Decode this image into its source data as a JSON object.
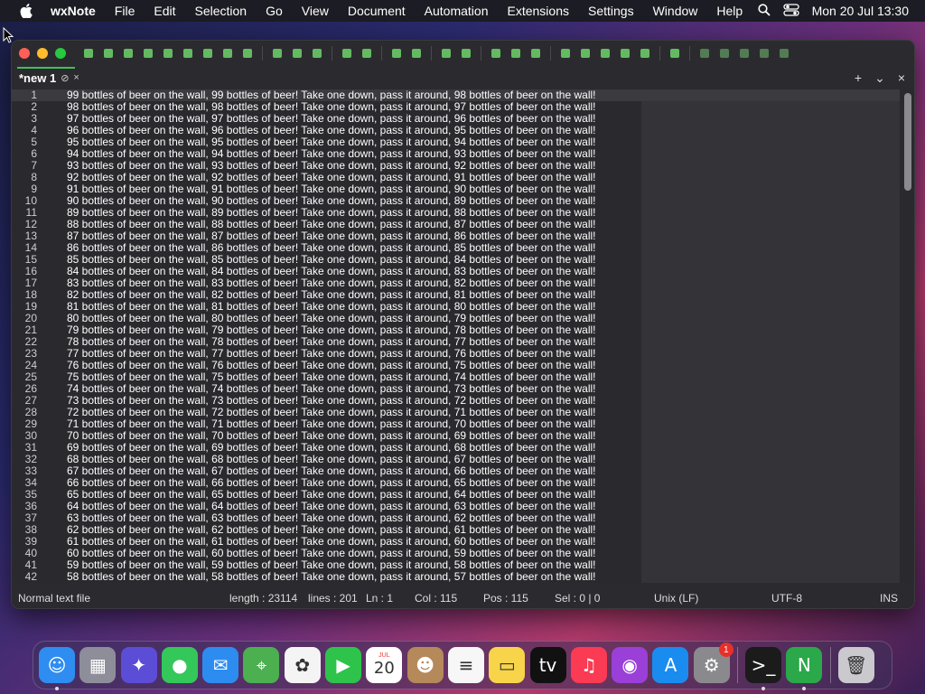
{
  "menubar": {
    "app_name": "wxNote",
    "items": [
      "File",
      "Edit",
      "Selection",
      "Go",
      "View",
      "Document",
      "Automation",
      "Extensions",
      "Settings",
      "Window",
      "Help"
    ],
    "clock": "Mon 20 Jul  13:30"
  },
  "window": {
    "toolbar_icons": [
      "new-file-icon",
      "open-icon",
      "open-folder-icon",
      "save-icon",
      "save-all-icon",
      "close-file-icon",
      "close-all-icon",
      "print-icon",
      "export-icon",
      "cut-icon",
      "copy-icon",
      "paste-icon",
      "undo-icon",
      "redo-icon",
      "find-icon",
      "highlight-icon",
      "zoom-in-icon",
      "zoom-out-icon",
      "wrap-icon",
      "indent-icon",
      "align-icon",
      "marker-icon",
      "checklist-icon",
      "crop-icon",
      "folder-icon",
      "terminal-icon",
      "preview-icon",
      "record-icon",
      "stop-icon",
      "play-icon",
      "replay-icon",
      "save-macro-icon"
    ],
    "tab": {
      "title": "*new 1",
      "pin_glyph": "⊘",
      "close_glyph": "×"
    },
    "tab_actions": {
      "add": "+",
      "list": "⌄",
      "close": "×"
    },
    "lines": [
      {
        "n": "1",
        "text": "99 bottles of beer on the wall, 99 bottles of beer! Take one down, pass it around, 98 bottles of beer on the wall!"
      },
      {
        "n": "2",
        "text": "98 bottles of beer on the wall, 98 bottles of beer! Take one down, pass it around, 97 bottles of beer on the wall!"
      },
      {
        "n": "3",
        "text": "97 bottles of beer on the wall, 97 bottles of beer! Take one down, pass it around, 96 bottles of beer on the wall!"
      },
      {
        "n": "4",
        "text": "96 bottles of beer on the wall, 96 bottles of beer! Take one down, pass it around, 95 bottles of beer on the wall!"
      },
      {
        "n": "5",
        "text": "95 bottles of beer on the wall, 95 bottles of beer! Take one down, pass it around, 94 bottles of beer on the wall!"
      },
      {
        "n": "6",
        "text": "94 bottles of beer on the wall, 94 bottles of beer! Take one down, pass it around, 93 bottles of beer on the wall!"
      },
      {
        "n": "7",
        "text": "93 bottles of beer on the wall, 93 bottles of beer! Take one down, pass it around, 92 bottles of beer on the wall!"
      },
      {
        "n": "8",
        "text": "92 bottles of beer on the wall, 92 bottles of beer! Take one down, pass it around, 91 bottles of beer on the wall!"
      },
      {
        "n": "9",
        "text": "91 bottles of beer on the wall, 91 bottles of beer! Take one down, pass it around, 90 bottles of beer on the wall!"
      },
      {
        "n": "10",
        "text": "90 bottles of beer on the wall, 90 bottles of beer! Take one down, pass it around, 89 bottles of beer on the wall!"
      },
      {
        "n": "11",
        "text": "89 bottles of beer on the wall, 89 bottles of beer! Take one down, pass it around, 88 bottles of beer on the wall!"
      },
      {
        "n": "12",
        "text": "88 bottles of beer on the wall, 88 bottles of beer! Take one down, pass it around, 87 bottles of beer on the wall!"
      },
      {
        "n": "13",
        "text": "87 bottles of beer on the wall, 87 bottles of beer! Take one down, pass it around, 86 bottles of beer on the wall!"
      },
      {
        "n": "14",
        "text": "86 bottles of beer on the wall, 86 bottles of beer! Take one down, pass it around, 85 bottles of beer on the wall!"
      },
      {
        "n": "15",
        "text": "85 bottles of beer on the wall, 85 bottles of beer! Take one down, pass it around, 84 bottles of beer on the wall!"
      },
      {
        "n": "16",
        "text": "84 bottles of beer on the wall, 84 bottles of beer! Take one down, pass it around, 83 bottles of beer on the wall!"
      },
      {
        "n": "17",
        "text": "83 bottles of beer on the wall, 83 bottles of beer! Take one down, pass it around, 82 bottles of beer on the wall!"
      },
      {
        "n": "18",
        "text": "82 bottles of beer on the wall, 82 bottles of beer! Take one down, pass it around, 81 bottles of beer on the wall!"
      },
      {
        "n": "19",
        "text": "81 bottles of beer on the wall, 81 bottles of beer! Take one down, pass it around, 80 bottles of beer on the wall!"
      },
      {
        "n": "20",
        "text": "80 bottles of beer on the wall, 80 bottles of beer! Take one down, pass it around, 79 bottles of beer on the wall!"
      },
      {
        "n": "21",
        "text": "79 bottles of beer on the wall, 79 bottles of beer! Take one down, pass it around, 78 bottles of beer on the wall!"
      },
      {
        "n": "22",
        "text": "78 bottles of beer on the wall, 78 bottles of beer! Take one down, pass it around, 77 bottles of beer on the wall!"
      },
      {
        "n": "23",
        "text": "77 bottles of beer on the wall, 77 bottles of beer! Take one down, pass it around, 76 bottles of beer on the wall!"
      },
      {
        "n": "24",
        "text": "76 bottles of beer on the wall, 76 bottles of beer! Take one down, pass it around, 75 bottles of beer on the wall!"
      },
      {
        "n": "25",
        "text": "75 bottles of beer on the wall, 75 bottles of beer! Take one down, pass it around, 74 bottles of beer on the wall!"
      },
      {
        "n": "26",
        "text": "74 bottles of beer on the wall, 74 bottles of beer! Take one down, pass it around, 73 bottles of beer on the wall!"
      },
      {
        "n": "27",
        "text": "73 bottles of beer on the wall, 73 bottles of beer! Take one down, pass it around, 72 bottles of beer on the wall!"
      },
      {
        "n": "28",
        "text": "72 bottles of beer on the wall, 72 bottles of beer! Take one down, pass it around, 71 bottles of beer on the wall!"
      },
      {
        "n": "29",
        "text": "71 bottles of beer on the wall, 71 bottles of beer! Take one down, pass it around, 70 bottles of beer on the wall!"
      },
      {
        "n": "30",
        "text": "70 bottles of beer on the wall, 70 bottles of beer! Take one down, pass it around, 69 bottles of beer on the wall!"
      },
      {
        "n": "31",
        "text": "69 bottles of beer on the wall, 69 bottles of beer! Take one down, pass it around, 68 bottles of beer on the wall!"
      },
      {
        "n": "32",
        "text": "68 bottles of beer on the wall, 68 bottles of beer! Take one down, pass it around, 67 bottles of beer on the wall!"
      },
      {
        "n": "33",
        "text": "67 bottles of beer on the wall, 67 bottles of beer! Take one down, pass it around, 66 bottles of beer on the wall!"
      },
      {
        "n": "34",
        "text": "66 bottles of beer on the wall, 66 bottles of beer! Take one down, pass it around, 65 bottles of beer on the wall!"
      },
      {
        "n": "35",
        "text": "65 bottles of beer on the wall, 65 bottles of beer! Take one down, pass it around, 64 bottles of beer on the wall!"
      },
      {
        "n": "36",
        "text": "64 bottles of beer on the wall, 64 bottles of beer! Take one down, pass it around, 63 bottles of beer on the wall!"
      },
      {
        "n": "37",
        "text": "63 bottles of beer on the wall, 63 bottles of beer! Take one down, pass it around, 62 bottles of beer on the wall!"
      },
      {
        "n": "38",
        "text": "62 bottles of beer on the wall, 62 bottles of beer! Take one down, pass it around, 61 bottles of beer on the wall!"
      },
      {
        "n": "39",
        "text": "61 bottles of beer on the wall, 61 bottles of beer! Take one down, pass it around, 60 bottles of beer on the wall!"
      },
      {
        "n": "40",
        "text": "60 bottles of beer on the wall, 60 bottles of beer! Take one down, pass it around, 59 bottles of beer on the wall!"
      },
      {
        "n": "41",
        "text": "59 bottles of beer on the wall, 59 bottles of beer! Take one down, pass it around, 58 bottles of beer on the wall!"
      },
      {
        "n": "42",
        "text": "58 bottles of beer on the wall, 58 bottles of beer! Take one down, pass it around, 57 bottles of beer on the wall!"
      }
    ],
    "status": {
      "file_type": "Normal text file",
      "length": "length : 23114",
      "lines": "lines : 201",
      "ln": "Ln : 1",
      "col": "Col : 115",
      "pos": "Pos : 115",
      "sel": "Sel : 0 | 0",
      "eol": "Unix (LF)",
      "encoding": "UTF-8",
      "mode": "INS"
    }
  },
  "dock": {
    "apps": [
      {
        "name": "finder",
        "color": "#2f8cf0",
        "glyph": "☺",
        "running": true
      },
      {
        "name": "launchpad",
        "color": "#8e8e9a",
        "glyph": "▦",
        "running": false
      },
      {
        "name": "siri",
        "color": "#5b4dd6",
        "glyph": "✦",
        "running": false
      },
      {
        "name": "messages",
        "color": "#34c759",
        "glyph": "●",
        "running": false
      },
      {
        "name": "mail",
        "color": "#2d8cf0",
        "glyph": "✉",
        "running": false
      },
      {
        "name": "maps",
        "color": "#4caf50",
        "glyph": "⌖",
        "running": false
      },
      {
        "name": "photos",
        "color": "#f4f4f4",
        "glyph": "✿",
        "running": false
      },
      {
        "name": "facetime",
        "color": "#2ec34a",
        "glyph": "▶",
        "running": false
      },
      {
        "name": "calendar",
        "color": "#ffffff",
        "glyph": "20",
        "running": false
      },
      {
        "name": "contacts",
        "color": "#b5895a",
        "glyph": "☻",
        "running": false
      },
      {
        "name": "reminders",
        "color": "#f7f7f7",
        "glyph": "≡",
        "running": false
      },
      {
        "name": "notes",
        "color": "#f7d44a",
        "glyph": "▭",
        "running": false
      },
      {
        "name": "tv",
        "color": "#111111",
        "glyph": "tv",
        "running": false
      },
      {
        "name": "music",
        "color": "#fa3b53",
        "glyph": "♫",
        "running": false
      },
      {
        "name": "podcasts",
        "color": "#9a3fd8",
        "glyph": "◉",
        "running": false
      },
      {
        "name": "app-store",
        "color": "#1a8cf0",
        "glyph": "A",
        "running": false
      },
      {
        "name": "system-preferences",
        "color": "#8a8a8e",
        "glyph": "⚙",
        "running": false,
        "badge": "1"
      },
      {
        "name": "terminal",
        "color": "#1b1b1b",
        "glyph": ">_",
        "running": true
      },
      {
        "name": "wxnote",
        "color": "#2aa84a",
        "glyph": "N",
        "running": true
      },
      {
        "name": "trash",
        "color": "#c9c9ce",
        "glyph": "🗑",
        "running": false
      }
    ],
    "calendar_month": "JUL"
  }
}
